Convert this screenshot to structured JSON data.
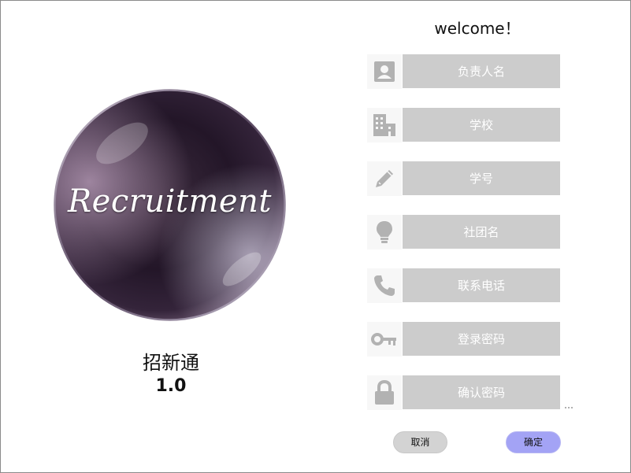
{
  "logo": {
    "text": "Recruitment"
  },
  "app": {
    "name": "招新通",
    "version": "1.0"
  },
  "form": {
    "welcome": "welcome！",
    "fields": [
      {
        "icon": "person-card-icon",
        "placeholder": "负责人名"
      },
      {
        "icon": "building-icon",
        "placeholder": "学校"
      },
      {
        "icon": "pencil-icon",
        "placeholder": "学号"
      },
      {
        "icon": "lightbulb-icon",
        "placeholder": "社团名"
      },
      {
        "icon": "phone-icon",
        "placeholder": "联系电话"
      },
      {
        "icon": "key-icon",
        "placeholder": "登录密码"
      },
      {
        "icon": "lock-icon",
        "placeholder": "确认密码"
      }
    ],
    "cancel_label": "取消",
    "confirm_label": "确定"
  },
  "colors": {
    "input_bg": "#cccccc",
    "icon_gray": "#b2b2b2",
    "confirm_bg": "#a3a3f5",
    "cancel_bg": "#d3d3d3"
  }
}
